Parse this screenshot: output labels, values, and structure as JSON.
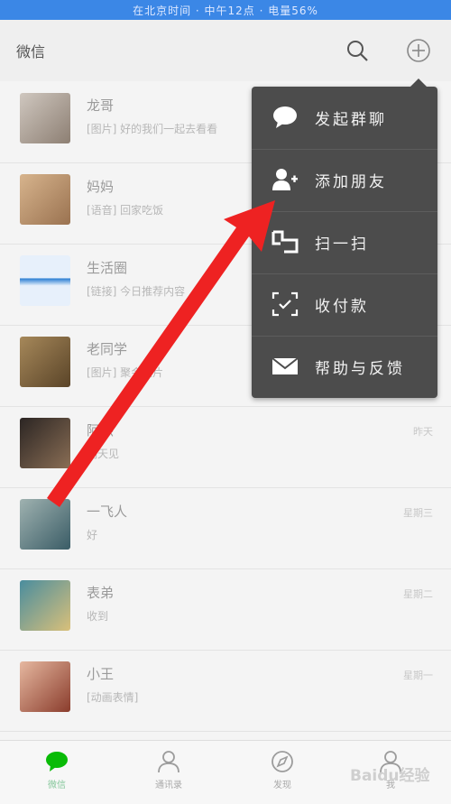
{
  "status_bar": {
    "text": "在北京时间 · 中午12点 · 电量56%"
  },
  "header": {
    "title": "微信",
    "search_icon": "search-icon",
    "add_icon": "plus-circle-icon"
  },
  "chats": [
    {
      "name": "龙哥",
      "message": "[图片] 好的我们一起去看看",
      "time": "",
      "avatar": [
        "#cfc7bf",
        "#8d7f73"
      ]
    },
    {
      "name": "妈妈",
      "message": "[语音] 回家吃饭",
      "time": "",
      "avatar": [
        "#d7b48d",
        "#9a7250"
      ]
    },
    {
      "name": "生活圈",
      "message": "[链接] 今日推荐内容",
      "time": "",
      "avatar": [
        "#e7f0fb",
        "#2a7ed3"
      ]
    },
    {
      "name": "老同学",
      "message": "[图片] 聚会照片",
      "time": "",
      "avatar": [
        "#a6885a",
        "#5a4428"
      ]
    },
    {
      "name": "阿杰",
      "message": "明天见",
      "time": "昨天",
      "avatar": [
        "#2b2523",
        "#8a6e55"
      ]
    },
    {
      "name": "一飞人",
      "message": "好",
      "time": "星期三",
      "avatar": [
        "#9fb2b0",
        "#3a5c66"
      ]
    },
    {
      "name": "表弟",
      "message": "收到",
      "time": "星期二",
      "avatar": [
        "#4a8d9e",
        "#d9c07a"
      ]
    },
    {
      "name": "小王",
      "message": "[动画表情]",
      "time": "星期一",
      "avatar": [
        "#e6b8a0",
        "#8a3c2c"
      ]
    }
  ],
  "menu": {
    "items": [
      {
        "icon": "chat-bubble-icon",
        "label": "发起群聊"
      },
      {
        "icon": "add-friend-icon",
        "label": "添加朋友"
      },
      {
        "icon": "scan-icon",
        "label": "扫一扫"
      },
      {
        "icon": "payment-scan-icon",
        "label": "收付款"
      },
      {
        "icon": "envelope-icon",
        "label": "帮助与反馈"
      }
    ]
  },
  "tabs": [
    {
      "label": "微信",
      "icon": "chat-tab-icon",
      "active": true
    },
    {
      "label": "通讯录",
      "icon": "contacts-tab-icon",
      "active": false
    },
    {
      "label": "发现",
      "icon": "discover-tab-icon",
      "active": false
    },
    {
      "label": "我",
      "icon": "me-tab-icon",
      "active": false
    }
  ],
  "watermark": "Baidu经验",
  "colors": {
    "menu_bg": "#4c4c4c",
    "accent_green": "#09bb07",
    "arrow_red": "#ee2222",
    "status_blue": "#3b87e6"
  }
}
